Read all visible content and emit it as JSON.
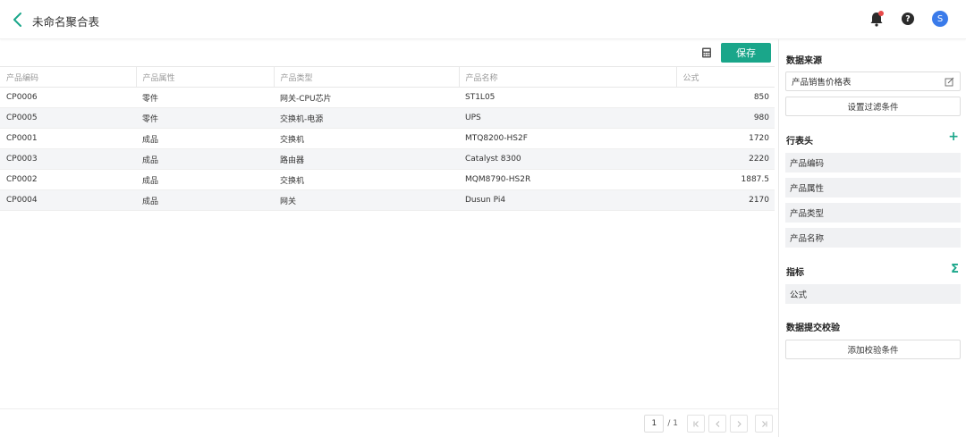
{
  "header": {
    "title": "未命名聚合表",
    "avatar_letter": "S"
  },
  "toolbar": {
    "save_label": "保存"
  },
  "table": {
    "columns": [
      "产品编码",
      "产品属性",
      "产品类型",
      "产品名称",
      "公式"
    ],
    "rows": [
      [
        "CP0006",
        "零件",
        "网关-CPU芯片",
        "ST1L05",
        "850"
      ],
      [
        "CP0005",
        "零件",
        "交换机-电源",
        "UPS",
        "980"
      ],
      [
        "CP0001",
        "成品",
        "交换机",
        "MTQ8200-HS2F",
        "1720"
      ],
      [
        "CP0003",
        "成品",
        "路由器",
        "Catalyst 8300",
        "2220"
      ],
      [
        "CP0002",
        "成品",
        "交换机",
        "MQM8790-HS2R",
        "1887.5"
      ],
      [
        "CP0004",
        "成品",
        "网关",
        "Dusun Pi4",
        "2170"
      ]
    ]
  },
  "pager": {
    "current": "1",
    "total": "/ 1"
  },
  "side": {
    "datasource_title": "数据来源",
    "datasource_value": "产品销售价格表",
    "filter_button": "设置过滤条件",
    "rowheader_title": "行表头",
    "rowheader_fields": [
      "产品编码",
      "产品属性",
      "产品类型",
      "产品名称"
    ],
    "metric_title": "指标",
    "metric_fields": [
      "公式"
    ],
    "validation_title": "数据提交校验",
    "validation_button": "添加校验条件"
  },
  "colors": {
    "accent": "#1aa68a",
    "avatar": "#3a7bea",
    "notify": "#e84a4a"
  }
}
